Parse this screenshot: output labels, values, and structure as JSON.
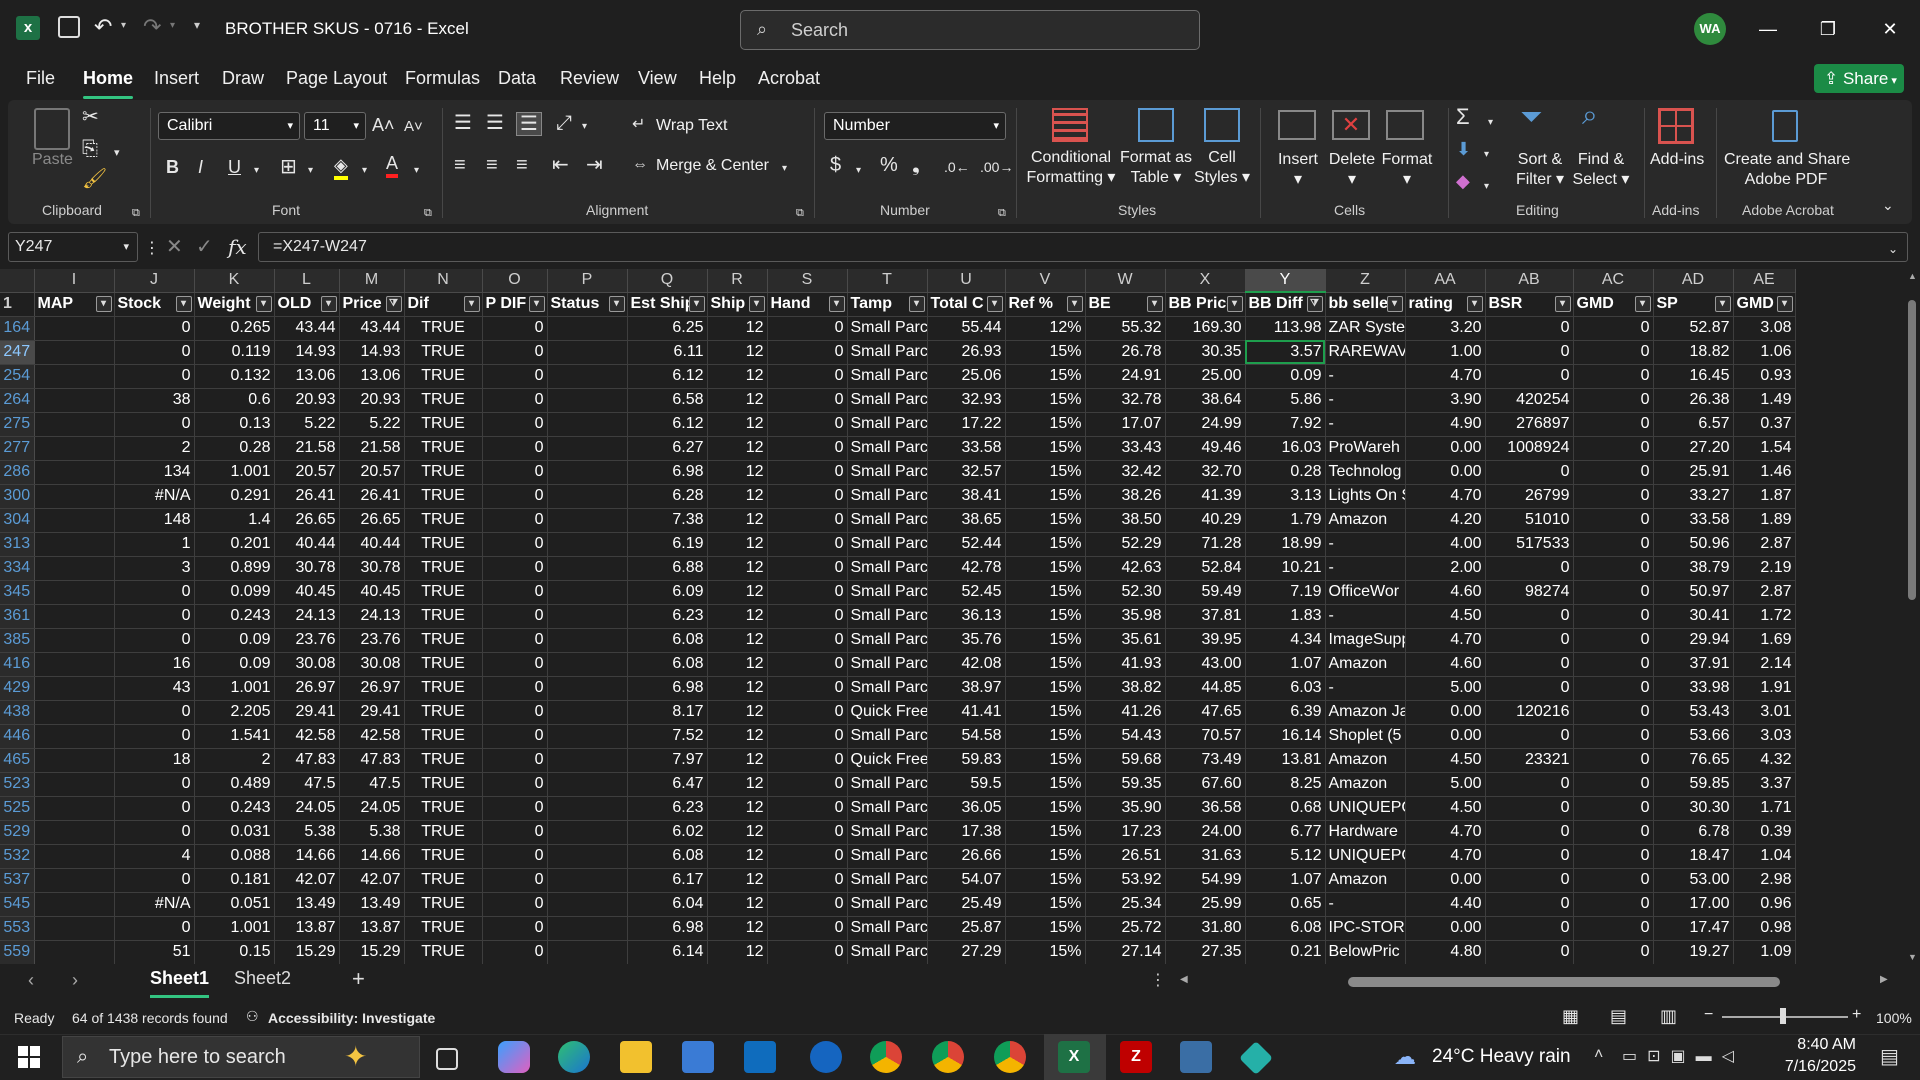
{
  "titlebar": {
    "doc_title": "BROTHER SKUS - 0716  -  Excel",
    "search_placeholder": "Search",
    "avatar_initials": "WA",
    "share_label": "Share"
  },
  "menu": [
    "File",
    "Home",
    "Insert",
    "Draw",
    "Page Layout",
    "Formulas",
    "Data",
    "Review",
    "View",
    "Help",
    "Acrobat"
  ],
  "ribbon": {
    "clipboard": {
      "paste": "Paste",
      "label": "Clipboard"
    },
    "font": {
      "name": "Calibri",
      "size": "11",
      "label": "Font"
    },
    "alignment": {
      "wrap": "Wrap Text",
      "merge": "Merge & Center",
      "label": "Alignment"
    },
    "number": {
      "format": "Number",
      "label": "Number"
    },
    "styles": {
      "cond1": "Conditional",
      "cond2": "Formatting",
      "fmt1": "Format as",
      "fmt2": "Table",
      "cell1": "Cell",
      "cell2": "Styles",
      "label": "Styles"
    },
    "cells": {
      "insert": "Insert",
      "delete": "Delete",
      "format": "Format",
      "label": "Cells"
    },
    "editing": {
      "sort1": "Sort &",
      "sort2": "Filter",
      "find1": "Find &",
      "find2": "Select",
      "label": "Editing"
    },
    "addins": {
      "btn": "Add-ins",
      "label": "Add-ins"
    },
    "acrobat": {
      "btn1": "Create and Share",
      "btn2": "Adobe PDF",
      "label": "Adobe Acrobat"
    }
  },
  "formula_bar": {
    "name_box": "Y247",
    "formula": "=X247-W247"
  },
  "columns": [
    "I",
    "J",
    "K",
    "L",
    "M",
    "N",
    "O",
    "P",
    "Q",
    "R",
    "S",
    "T",
    "U",
    "V",
    "W",
    "X",
    "Y",
    "Z",
    "AA",
    "AB",
    "AC",
    "AD",
    "AE"
  ],
  "selected_column": "Y",
  "headers": [
    "MAP",
    "Stock",
    "Weight",
    "OLD",
    "Price",
    "Dif",
    "P DIF",
    "Status",
    "Est Ship",
    "Ship",
    "Hand",
    "Tamp",
    "Total C",
    "Ref %",
    "BE",
    "BB Price",
    "BB Diff",
    "bb seller",
    "rating",
    "BSR",
    "GMD",
    "SP",
    "GMD S"
  ],
  "filtered_headers": [
    "Price",
    "BB Diff"
  ],
  "rows": [
    [
      "164",
      "",
      "0",
      "0.265",
      "43.44",
      "43.44",
      "TRUE",
      "0",
      "",
      "6.25",
      "12",
      "0",
      "Small Parc",
      "55.44",
      "12%",
      "55.32",
      "169.30",
      "113.98",
      "ZAR Syster",
      "3.20",
      "0",
      "0",
      "52.87",
      "3.08"
    ],
    [
      "247",
      "",
      "0",
      "0.119",
      "14.93",
      "14.93",
      "TRUE",
      "0",
      "",
      "6.11",
      "12",
      "0",
      "Small Parc",
      "26.93",
      "15%",
      "26.78",
      "30.35",
      "3.57",
      "RAREWAV",
      "1.00",
      "0",
      "0",
      "18.82",
      "1.06"
    ],
    [
      "254",
      "",
      "0",
      "0.132",
      "13.06",
      "13.06",
      "TRUE",
      "0",
      "",
      "6.12",
      "12",
      "0",
      "Small Parc",
      "25.06",
      "15%",
      "24.91",
      "25.00",
      "0.09",
      "-",
      "4.70",
      "0",
      "0",
      "16.45",
      "0.93"
    ],
    [
      "264",
      "",
      "38",
      "0.6",
      "20.93",
      "20.93",
      "TRUE",
      "0",
      "",
      "6.58",
      "12",
      "0",
      "Small Parc",
      "32.93",
      "15%",
      "32.78",
      "38.64",
      "5.86",
      "-",
      "3.90",
      "420254",
      "0",
      "26.38",
      "1.49"
    ],
    [
      "275",
      "",
      "0",
      "0.13",
      "5.22",
      "5.22",
      "TRUE",
      "0",
      "",
      "6.12",
      "12",
      "0",
      "Small Parc",
      "17.22",
      "15%",
      "17.07",
      "24.99",
      "7.92",
      "-",
      "4.90",
      "276897",
      "0",
      "6.57",
      "0.37"
    ],
    [
      "277",
      "",
      "2",
      "0.28",
      "21.58",
      "21.58",
      "TRUE",
      "0",
      "",
      "6.27",
      "12",
      "0",
      "Small Parc",
      "33.58",
      "15%",
      "33.43",
      "49.46",
      "16.03",
      "ProWareh",
      "0.00",
      "1008924",
      "0",
      "27.20",
      "1.54"
    ],
    [
      "286",
      "",
      "134",
      "1.001",
      "20.57",
      "20.57",
      "TRUE",
      "0",
      "",
      "6.98",
      "12",
      "0",
      "Small Parc",
      "32.57",
      "15%",
      "32.42",
      "32.70",
      "0.28",
      "Technolog",
      "0.00",
      "0",
      "0",
      "25.91",
      "1.46"
    ],
    [
      "300",
      "",
      "#N/A",
      "0.291",
      "26.41",
      "26.41",
      "TRUE",
      "0",
      "",
      "6.28",
      "12",
      "0",
      "Small Parc",
      "38.41",
      "15%",
      "38.26",
      "41.39",
      "3.13",
      "Lights On S",
      "4.70",
      "26799",
      "0",
      "33.27",
      "1.87"
    ],
    [
      "304",
      "",
      "148",
      "1.4",
      "26.65",
      "26.65",
      "TRUE",
      "0",
      "",
      "7.38",
      "12",
      "0",
      "Small Parc",
      "38.65",
      "15%",
      "38.50",
      "40.29",
      "1.79",
      "Amazon",
      "4.20",
      "51010",
      "0",
      "33.58",
      "1.89"
    ],
    [
      "313",
      "",
      "1",
      "0.201",
      "40.44",
      "40.44",
      "TRUE",
      "0",
      "",
      "6.19",
      "12",
      "0",
      "Small Parc",
      "52.44",
      "15%",
      "52.29",
      "71.28",
      "18.99",
      "-",
      "4.00",
      "517533",
      "0",
      "50.96",
      "2.87"
    ],
    [
      "334",
      "",
      "3",
      "0.899",
      "30.78",
      "30.78",
      "TRUE",
      "0",
      "",
      "6.88",
      "12",
      "0",
      "Small Parc",
      "42.78",
      "15%",
      "42.63",
      "52.84",
      "10.21",
      "-",
      "2.00",
      "0",
      "0",
      "38.79",
      "2.19"
    ],
    [
      "345",
      "",
      "0",
      "0.099",
      "40.45",
      "40.45",
      "TRUE",
      "0",
      "",
      "6.09",
      "12",
      "0",
      "Small Parc",
      "52.45",
      "15%",
      "52.30",
      "59.49",
      "7.19",
      "OfficeWor",
      "4.60",
      "98274",
      "0",
      "50.97",
      "2.87"
    ],
    [
      "361",
      "",
      "0",
      "0.243",
      "24.13",
      "24.13",
      "TRUE",
      "0",
      "",
      "6.23",
      "12",
      "0",
      "Small Parc",
      "36.13",
      "15%",
      "35.98",
      "37.81",
      "1.83",
      "-",
      "4.50",
      "0",
      "0",
      "30.41",
      "1.72"
    ],
    [
      "385",
      "",
      "0",
      "0.09",
      "23.76",
      "23.76",
      "TRUE",
      "0",
      "",
      "6.08",
      "12",
      "0",
      "Small Parc",
      "35.76",
      "15%",
      "35.61",
      "39.95",
      "4.34",
      "ImageSupp",
      "4.70",
      "0",
      "0",
      "29.94",
      "1.69"
    ],
    [
      "416",
      "",
      "16",
      "0.09",
      "30.08",
      "30.08",
      "TRUE",
      "0",
      "",
      "6.08",
      "12",
      "0",
      "Small Parc",
      "42.08",
      "15%",
      "41.93",
      "43.00",
      "1.07",
      "Amazon",
      "4.60",
      "0",
      "0",
      "37.91",
      "2.14"
    ],
    [
      "429",
      "",
      "43",
      "1.001",
      "26.97",
      "26.97",
      "TRUE",
      "0",
      "",
      "6.98",
      "12",
      "0",
      "Small Parc",
      "38.97",
      "15%",
      "38.82",
      "44.85",
      "6.03",
      "-",
      "5.00",
      "0",
      "0",
      "33.98",
      "1.91"
    ],
    [
      "438",
      "",
      "0",
      "2.205",
      "29.41",
      "29.41",
      "TRUE",
      "0",
      "",
      "8.17",
      "12",
      "0",
      "Quick Free",
      "41.41",
      "15%",
      "41.26",
      "47.65",
      "6.39",
      "Amazon Ja",
      "0.00",
      "120216",
      "0",
      "53.43",
      "3.01"
    ],
    [
      "446",
      "",
      "0",
      "1.541",
      "42.58",
      "42.58",
      "TRUE",
      "0",
      "",
      "7.52",
      "12",
      "0",
      "Small Parc",
      "54.58",
      "15%",
      "54.43",
      "70.57",
      "16.14",
      "Shoplet (5",
      "0.00",
      "0",
      "0",
      "53.66",
      "3.03"
    ],
    [
      "465",
      "",
      "18",
      "2",
      "47.83",
      "47.83",
      "TRUE",
      "0",
      "",
      "7.97",
      "12",
      "0",
      "Quick Free",
      "59.83",
      "15%",
      "59.68",
      "73.49",
      "13.81",
      "Amazon",
      "4.50",
      "23321",
      "0",
      "76.65",
      "4.32"
    ],
    [
      "523",
      "",
      "0",
      "0.489",
      "47.5",
      "47.5",
      "TRUE",
      "0",
      "",
      "6.47",
      "12",
      "0",
      "Small Parc",
      "59.5",
      "15%",
      "59.35",
      "67.60",
      "8.25",
      "Amazon",
      "5.00",
      "0",
      "0",
      "59.85",
      "3.37"
    ],
    [
      "525",
      "",
      "0",
      "0.243",
      "24.05",
      "24.05",
      "TRUE",
      "0",
      "",
      "6.23",
      "12",
      "0",
      "Small Parc",
      "36.05",
      "15%",
      "35.90",
      "36.58",
      "0.68",
      "UNIQUEPC",
      "4.50",
      "0",
      "0",
      "30.30",
      "1.71"
    ],
    [
      "529",
      "",
      "0",
      "0.031",
      "5.38",
      "5.38",
      "TRUE",
      "0",
      "",
      "6.02",
      "12",
      "0",
      "Small Parc",
      "17.38",
      "15%",
      "17.23",
      "24.00",
      "6.77",
      "Hardware",
      "4.70",
      "0",
      "0",
      "6.78",
      "0.39"
    ],
    [
      "532",
      "",
      "4",
      "0.088",
      "14.66",
      "14.66",
      "TRUE",
      "0",
      "",
      "6.08",
      "12",
      "0",
      "Small Parc",
      "26.66",
      "15%",
      "26.51",
      "31.63",
      "5.12",
      "UNIQUEPC",
      "4.70",
      "0",
      "0",
      "18.47",
      "1.04"
    ],
    [
      "537",
      "",
      "0",
      "0.181",
      "42.07",
      "42.07",
      "TRUE",
      "0",
      "",
      "6.17",
      "12",
      "0",
      "Small Parc",
      "54.07",
      "15%",
      "53.92",
      "54.99",
      "1.07",
      "Amazon",
      "0.00",
      "0",
      "0",
      "53.00",
      "2.98"
    ],
    [
      "545",
      "",
      "#N/A",
      "0.051",
      "13.49",
      "13.49",
      "TRUE",
      "0",
      "",
      "6.04",
      "12",
      "0",
      "Small Parc",
      "25.49",
      "15%",
      "25.34",
      "25.99",
      "0.65",
      "-",
      "4.40",
      "0",
      "0",
      "17.00",
      "0.96"
    ],
    [
      "553",
      "",
      "0",
      "1.001",
      "13.87",
      "13.87",
      "TRUE",
      "0",
      "",
      "6.98",
      "12",
      "0",
      "Small Parc",
      "25.87",
      "15%",
      "25.72",
      "31.80",
      "6.08",
      "IPC-STORE",
      "0.00",
      "0",
      "0",
      "17.47",
      "0.98"
    ],
    [
      "559",
      "",
      "51",
      "0.15",
      "15.29",
      "15.29",
      "TRUE",
      "0",
      "",
      "6.14",
      "12",
      "0",
      "Small Parc",
      "27.29",
      "15%",
      "27.14",
      "27.35",
      "0.21",
      "BelowPric",
      "4.80",
      "0",
      "0",
      "19.27",
      "1.09"
    ]
  ],
  "sheets": [
    "Sheet1",
    "Sheet2"
  ],
  "active_sheet": "Sheet1",
  "status": {
    "ready": "Ready",
    "records": "64 of 1438 records found",
    "accessibility": "Accessibility: Investigate",
    "zoom": "100%"
  },
  "taskbar": {
    "search": "Type here to search",
    "weather": "24°C  Heavy rain",
    "time": "8:40 AM",
    "date": "7/16/2025"
  },
  "colors": {
    "excel_green": "#1e9e4d",
    "share_green": "#1b8b46",
    "avatar": "#2f8a3d",
    "header_link": "#5b9bd5"
  }
}
